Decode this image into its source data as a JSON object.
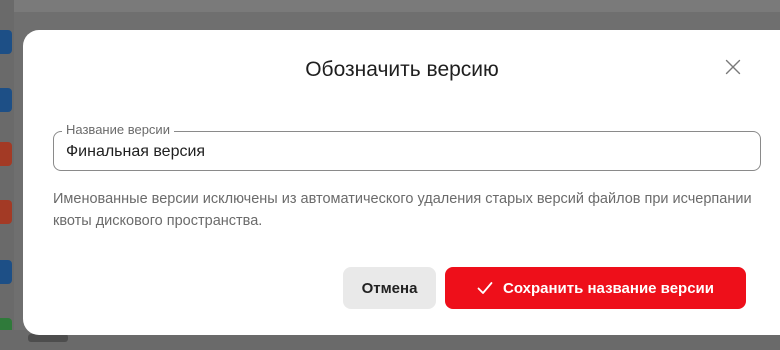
{
  "dialog": {
    "title": "Обозначить версию",
    "close_icon": "close-icon",
    "field": {
      "legend": "Название версии",
      "value": "Финальная версия"
    },
    "description": "Именованные версии исключены из автоматического удаления старых версий файлов при исчерпании квоты дискового пространства.",
    "buttons": {
      "cancel_label": "Отмена",
      "save_label": "Сохранить название версии",
      "save_icon": "check-icon"
    }
  },
  "colors": {
    "primary": "#ee0f1a",
    "secondary_button": "#e9e9e9",
    "overlay": "#6f6f6f"
  }
}
